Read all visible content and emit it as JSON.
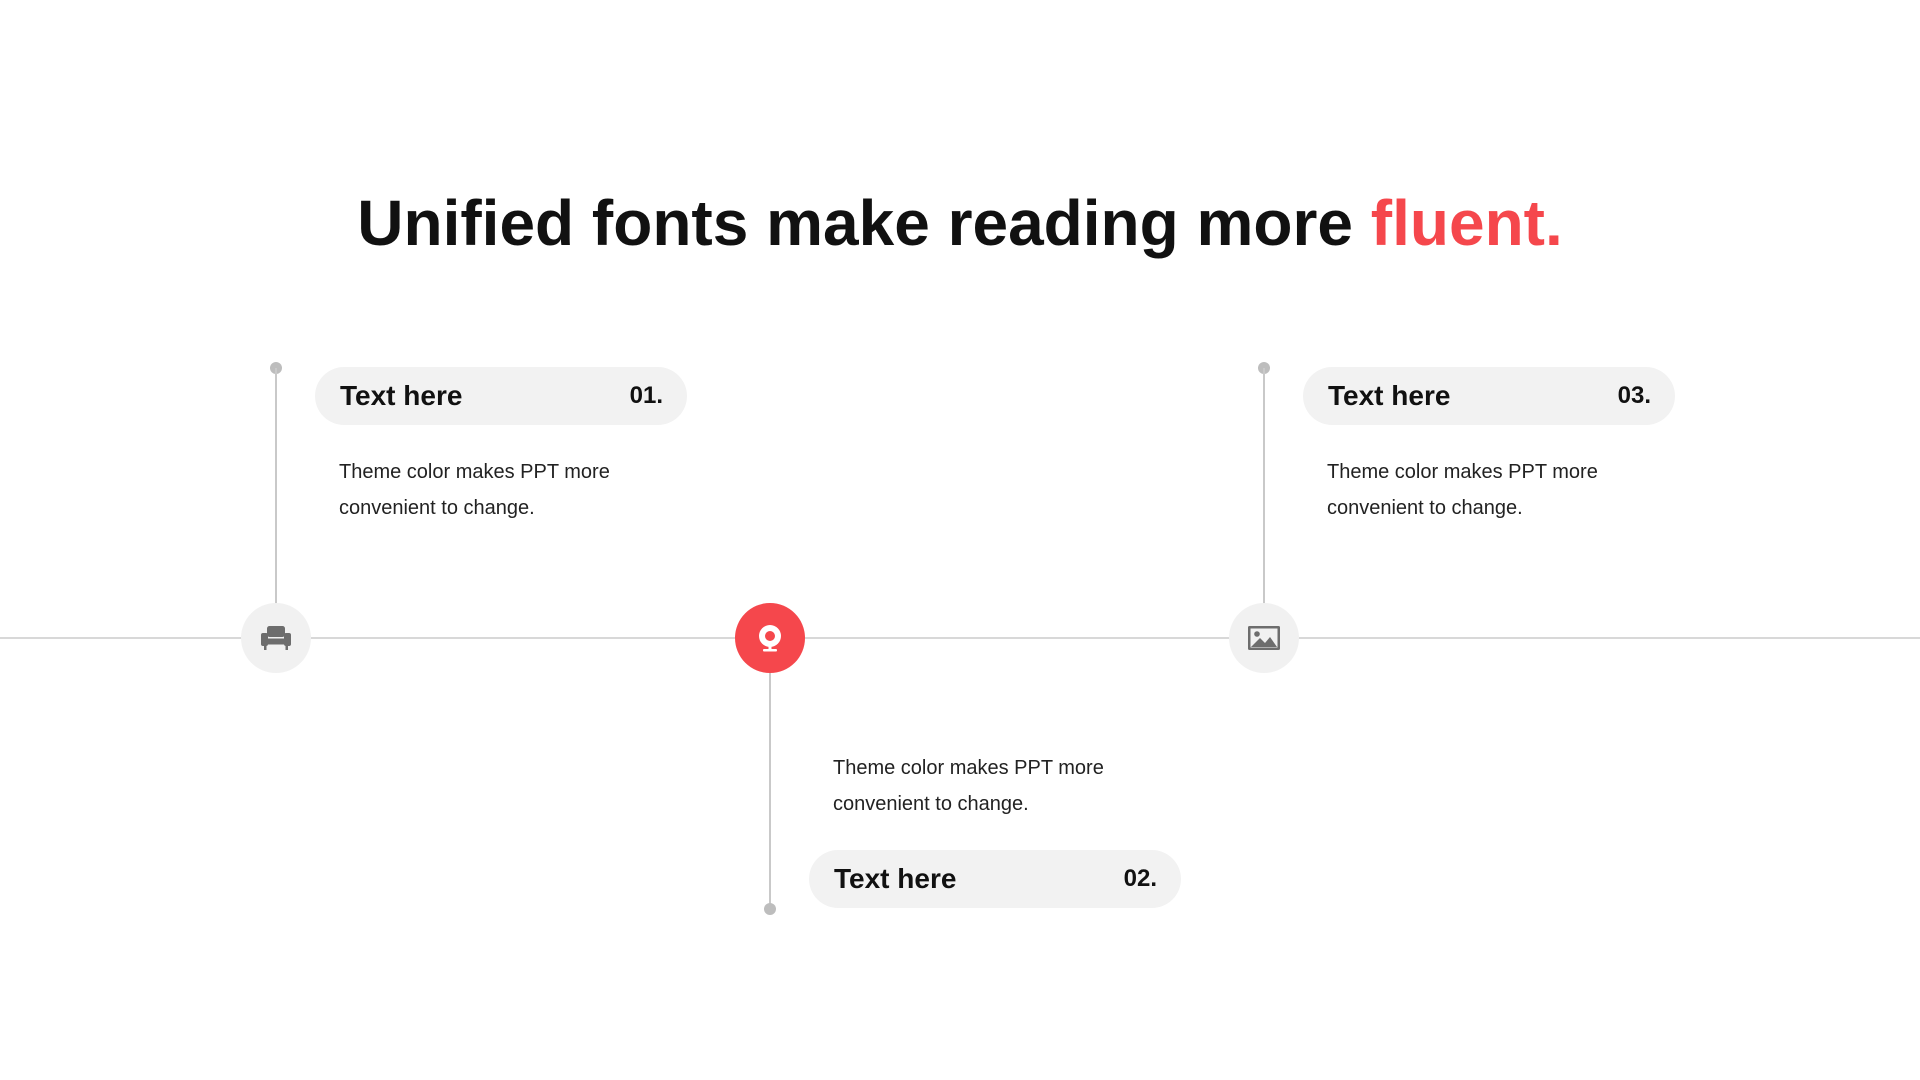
{
  "slide": {
    "title_main": "Unified fonts make reading more ",
    "title_accent": "fluent.",
    "accent_color": "#f5474c",
    "items": [
      {
        "title": "Text here",
        "number": "01.",
        "description": "Theme color makes PPT more convenient to change.",
        "icon": "armchair-icon",
        "active": false
      },
      {
        "title": "Text here",
        "number": "02.",
        "description": "Theme color makes PPT more convenient to change.",
        "icon": "webcam-icon",
        "active": true
      },
      {
        "title": "Text here",
        "number": "03.",
        "description": "Theme color makes PPT more convenient to change.",
        "icon": "image-icon",
        "active": false
      }
    ]
  }
}
